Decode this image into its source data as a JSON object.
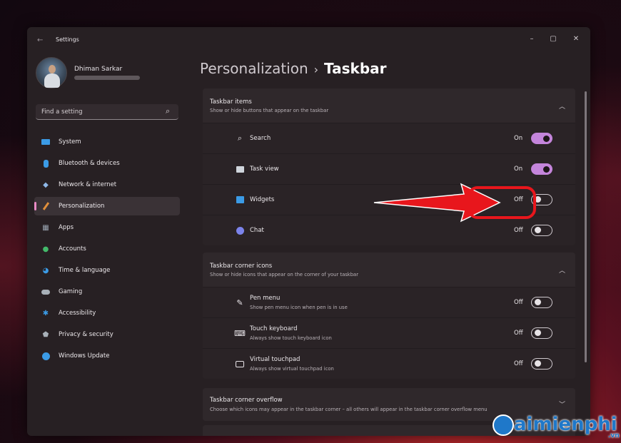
{
  "window": {
    "title": "Settings",
    "controls": {
      "minimize": "–",
      "maximize": "▢",
      "close": "✕"
    }
  },
  "profile": {
    "name": "Dhiman Sarkar"
  },
  "search": {
    "placeholder": "Find a setting"
  },
  "sidebar": {
    "items": [
      {
        "label": "System",
        "icon": "system-icon",
        "color": "#3b9be6"
      },
      {
        "label": "Bluetooth & devices",
        "icon": "bluetooth-icon",
        "color": "#3b9be6"
      },
      {
        "label": "Network & internet",
        "icon": "wifi-icon",
        "color": "#8fb8e8"
      },
      {
        "label": "Personalization",
        "icon": "brush-icon",
        "color": "#e08f3b",
        "selected": true
      },
      {
        "label": "Apps",
        "icon": "apps-icon",
        "color": "#9aa5b1"
      },
      {
        "label": "Accounts",
        "icon": "person-icon",
        "color": "#43b96a"
      },
      {
        "label": "Time & language",
        "icon": "globe-clock-icon",
        "color": "#3b9be6"
      },
      {
        "label": "Gaming",
        "icon": "gamepad-icon",
        "color": "#a8b0b8"
      },
      {
        "label": "Accessibility",
        "icon": "accessibility-icon",
        "color": "#3b9be6"
      },
      {
        "label": "Privacy & security",
        "icon": "shield-icon",
        "color": "#a8b0b8"
      },
      {
        "label": "Windows Update",
        "icon": "update-icon",
        "color": "#3b9be6"
      }
    ]
  },
  "breadcrumb": {
    "parent": "Personalization",
    "separator": "›",
    "current": "Taskbar"
  },
  "sections": {
    "taskbar_items": {
      "title": "Taskbar items",
      "subtitle": "Show or hide buttons that appear on the taskbar",
      "rows": [
        {
          "label": "Search",
          "state": "On",
          "on": true
        },
        {
          "label": "Task view",
          "state": "On",
          "on": true
        },
        {
          "label": "Widgets",
          "state": "Off",
          "on": false
        },
        {
          "label": "Chat",
          "state": "Off",
          "on": false
        }
      ]
    },
    "corner_icons": {
      "title": "Taskbar corner icons",
      "subtitle": "Show or hide icons that appear on the corner of your taskbar",
      "rows": [
        {
          "label": "Pen menu",
          "sub": "Show pen menu icon when pen is in use",
          "state": "Off"
        },
        {
          "label": "Touch keyboard",
          "sub": "Always show touch keyboard icon",
          "state": "Off"
        },
        {
          "label": "Virtual touchpad",
          "sub": "Always show virtual touchpad icon",
          "state": "Off"
        }
      ]
    },
    "corner_overflow": {
      "title": "Taskbar corner overflow",
      "subtitle": "Choose which icons may appear in the taskbar corner – all others will appear in the taskbar corner overflow menu"
    }
  },
  "colors": {
    "toggle_on": "#c485db",
    "highlight": "#e8161c",
    "accent": "#e88ac4"
  },
  "watermark": {
    "text": "aimienphi",
    "suffix": ".vn"
  }
}
